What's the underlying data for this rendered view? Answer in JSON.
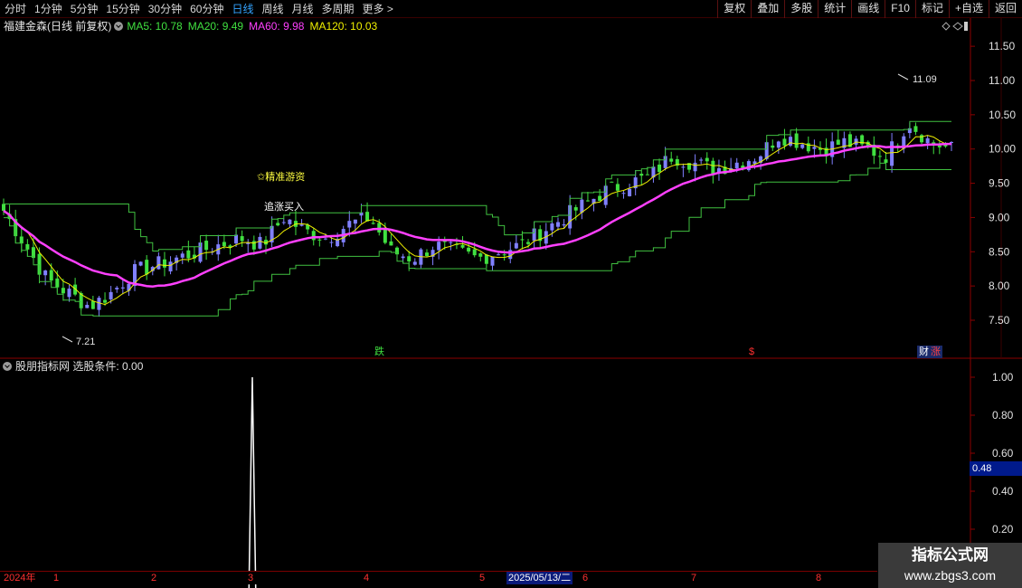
{
  "toolbar": {
    "period_tabs": [
      "分时",
      "1分钟",
      "5分钟",
      "15分钟",
      "30分钟",
      "60分钟",
      "日线",
      "周线",
      "月线",
      "多周期",
      "更多"
    ],
    "active_tab": "日线",
    "more_arrow": ">",
    "right_tools": [
      "复权",
      "叠加",
      "多股",
      "统计",
      "画线",
      "F10",
      "标记",
      "+自选",
      "返回"
    ]
  },
  "main_chart": {
    "title": "福建金森(日线 前复权)",
    "ma_labels": [
      {
        "text": "MA5: 10.78",
        "color": "#40e040"
      },
      {
        "text": "MA20: 9.49",
        "color": "#40e040"
      },
      {
        "text": "MA60: 9.98",
        "color": "#ff40ff"
      },
      {
        "text": "MA120: 10.03",
        "color": "#f0f000"
      }
    ],
    "price_axis": [
      "11.50",
      "11.00",
      "10.50",
      "10.00",
      "9.50",
      "9.00",
      "8.50",
      "8.00",
      "7.50"
    ],
    "high_mark": "11.09",
    "low_mark": "7.21",
    "annotations": {
      "jingzhun": "精准游资",
      "zhuizhang": "追涨买入",
      "die": "跌",
      "dollar": "$",
      "cai": "财",
      "zhang": "涨"
    },
    "colors": {
      "up": "#8080ff",
      "down": "#40e040",
      "ma5": "#f0f000",
      "ma_main": "#ff40ff",
      "band": "#40c040",
      "axis": "#8b0000"
    }
  },
  "indicator": {
    "title": "股朋指标网",
    "condition": "选股条件: 0.00",
    "axis": [
      "1.00",
      "0.80",
      "0.60",
      "0.40",
      "0.20"
    ],
    "current_value": "0.48"
  },
  "date_axis": {
    "labels": [
      "2024年",
      "1",
      "2",
      "3",
      "4",
      "5",
      "2025/05/13/二",
      "6",
      "7",
      "8"
    ],
    "selected": "2025/05/13/二"
  },
  "watermark": {
    "title": "指标公式网",
    "url": "www.zbgs3.com"
  },
  "chart_data": {
    "type": "table",
    "title": "",
    "candles_close_approx": [
      9.1,
      8.6,
      8.1,
      7.9,
      7.7,
      7.9,
      8.2,
      8.3,
      8.4,
      8.5,
      8.6,
      8.7,
      8.6,
      9.0,
      8.8,
      8.7,
      8.9,
      9.0,
      8.5,
      8.4,
      8.6,
      8.5,
      8.4,
      8.5,
      8.6,
      8.8,
      9.0,
      9.2,
      9.4,
      9.5,
      9.6,
      9.9,
      9.8,
      9.7,
      9.8,
      9.9,
      10.2,
      10.1,
      10.0,
      10.1,
      10.0,
      9.9,
      10.4,
      10.1,
      10.0
    ],
    "indicator_spike": 1.0
  }
}
